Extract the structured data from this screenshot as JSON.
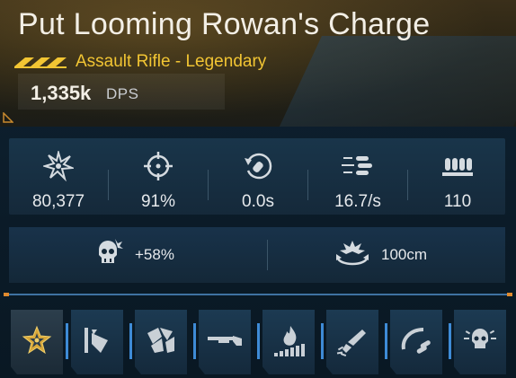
{
  "weapon": {
    "name": "Put Looming Rowan's Charge",
    "type_rarity": "Assault Rifle - Legendary",
    "rarity_icon": "legendary-chevrons-icon",
    "dps_value": "1,335k",
    "dps_unit": "DPS"
  },
  "stats": [
    {
      "icon": "impact-burst-icon",
      "value": "80,377"
    },
    {
      "icon": "crosshair-icon",
      "value": "91%"
    },
    {
      "icon": "reload-icon",
      "value": "0.0s"
    },
    {
      "icon": "fire-rate-bullets-icon",
      "value": "16.7/s"
    },
    {
      "icon": "magazine-ammo-icon",
      "value": "110"
    }
  ],
  "secondary_stats": [
    {
      "icon": "weakspot-skull-icon",
      "value": "+58%"
    },
    {
      "icon": "explosion-range-icon",
      "value": "100cm"
    }
  ],
  "perks": [
    {
      "icon": "star-burst-perk-icon",
      "active": true
    },
    {
      "icon": "wall-knockback-perk-icon",
      "active": false
    },
    {
      "icon": "armor-shards-perk-icon",
      "active": false
    },
    {
      "icon": "shotgun-perk-icon",
      "active": false
    },
    {
      "icon": "burn-flame-perk-icon",
      "active": false
    },
    {
      "icon": "pistol-spread-perk-icon",
      "active": false
    },
    {
      "icon": "ammo-bullets-perk-icon",
      "active": false
    },
    {
      "icon": "skull-blast-perk-icon",
      "active": false
    }
  ],
  "colors": {
    "accent_gold": "#f2c533",
    "accent_blue": "#3e8bd6",
    "accent_orange": "#e08a2e",
    "text": "#e6e9ec"
  }
}
